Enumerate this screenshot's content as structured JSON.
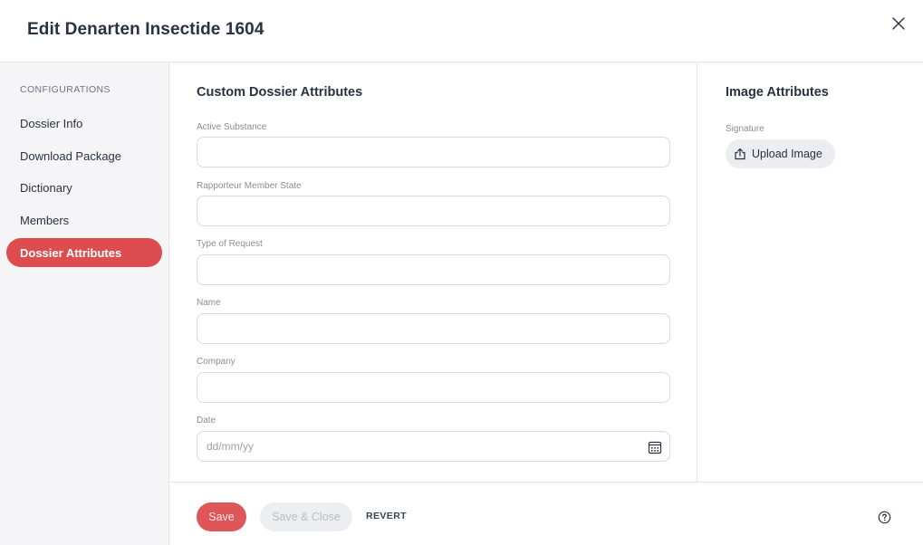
{
  "header": {
    "title": "Edit Denarten Insectide 1604"
  },
  "sidebar": {
    "heading": "CONFIGURATIONS",
    "items": [
      {
        "label": "Dossier Info",
        "active": false
      },
      {
        "label": "Download Package",
        "active": false
      },
      {
        "label": "Dictionary",
        "active": false
      },
      {
        "label": "Members",
        "active": false
      },
      {
        "label": "Dossier Attributes",
        "active": true
      }
    ]
  },
  "main": {
    "title": "Custom Dossier Attributes",
    "fields": [
      {
        "label": "Active Substance",
        "value": "",
        "placeholder": ""
      },
      {
        "label": "Rapporteur Member State",
        "value": "",
        "placeholder": ""
      },
      {
        "label": "Type of Request",
        "value": "",
        "placeholder": ""
      },
      {
        "label": "Name",
        "value": "",
        "placeholder": ""
      },
      {
        "label": "Company",
        "value": "",
        "placeholder": ""
      },
      {
        "label": "Date",
        "value": "",
        "placeholder": "dd/mm/yy"
      }
    ]
  },
  "image_attributes": {
    "title": "Image Attributes",
    "signature_label": "Signature",
    "upload_label": "Upload Image"
  },
  "footer": {
    "save_label": "Save",
    "save_close_label": "Save & Close",
    "revert_label": "REVERT"
  },
  "colors": {
    "accent": "#dd4d50",
    "sidebar_bg": "#f5f5f7",
    "text": "#283241"
  },
  "icons": {
    "close": "close-icon",
    "upload": "upload-icon",
    "calendar": "calendar-icon",
    "help": "help-icon"
  }
}
